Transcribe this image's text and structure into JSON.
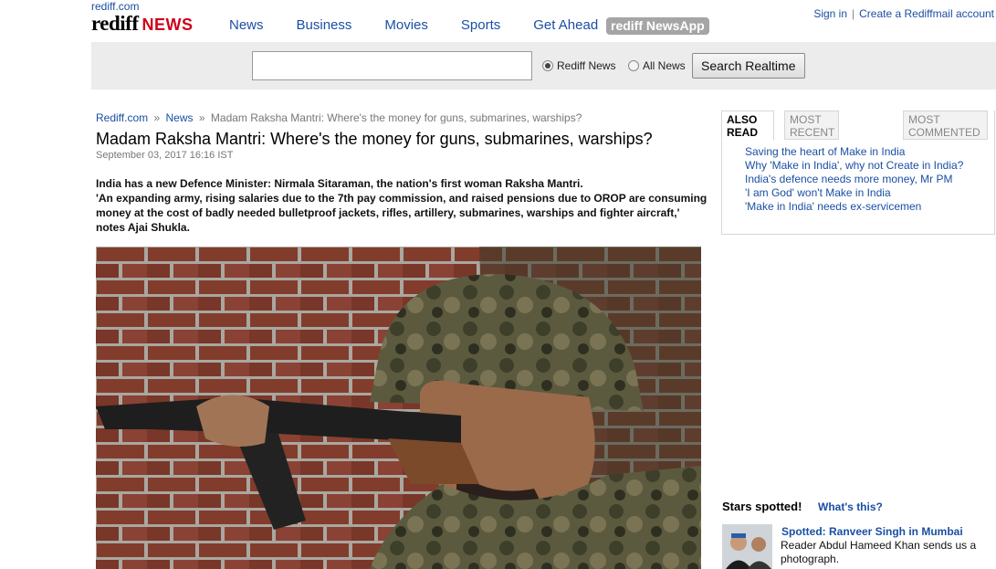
{
  "header": {
    "site_link": "rediff.com",
    "logo_main": "rediff",
    "logo_news": "NEWS",
    "nav": [
      "News",
      "Business",
      "Movies",
      "Sports",
      "Get Ahead"
    ],
    "app_badge": "rediff NewsApp",
    "sign_in": "Sign in",
    "separator": "|",
    "create_account": "Create a Rediffmail account"
  },
  "search": {
    "value": "",
    "radio_rediff": "Rediff News",
    "radio_all": "All News",
    "selected": "Rediff News",
    "button": "Search Realtime"
  },
  "breadcrumb": {
    "home": "Rediff.com",
    "sep": "»",
    "section": "News",
    "current": "Madam Raksha Mantri: Where's the money for guns, submarines, warships?"
  },
  "article": {
    "headline": "Madam Raksha Mantri: Where's the money for guns, submarines, warships?",
    "date": "September 03, 2017 16:16 IST",
    "intro_1": "India has a new Defence Minister: Nirmala Sitaraman, the nation's first woman Raksha Mantri.",
    "intro_2": "'An expanding army, rising salaries due to the 7th pay commission, and raised pensions due to OROP are consuming money at the cost of badly needed bulletproof jackets, rifles, artillery, submarines, warships and fighter aircraft,' notes Ajai Shukla."
  },
  "sidebar": {
    "tabs": [
      {
        "line1": "ALSO",
        "line2": "READ"
      },
      {
        "line1": "MOST",
        "line2": "RECENT"
      },
      {
        "line1": "MOST",
        "line2": "COMMENTED"
      }
    ],
    "also_read": [
      "Saving the heart of Make in India",
      "Why 'Make in India', why not Create in India?",
      "India's defence needs more money, Mr PM",
      "'I am God' won't Make in India",
      "'Make in India' needs ex-servicemen"
    ]
  },
  "stars": {
    "title": "Stars spotted!",
    "whats_this": "What's this?",
    "headline": "Spotted: Ranveer Singh in Mumbai",
    "text": "Reader Abdul Hameed Khan sends us a photograph."
  },
  "colors": {
    "link": "#1a4fa3",
    "logo_red": "#d0021b",
    "search_bar_bg": "#ececec",
    "app_badge_bg": "#a5a5a5"
  }
}
